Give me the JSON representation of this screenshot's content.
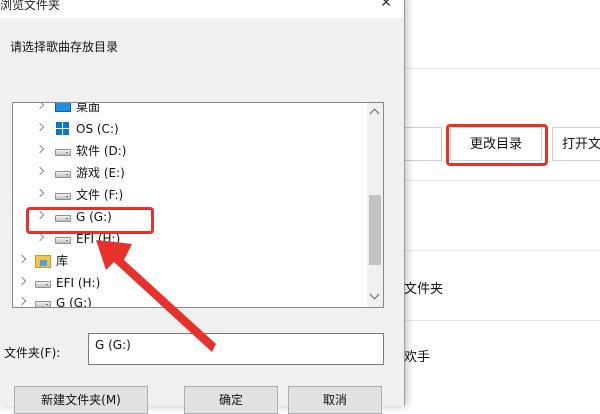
{
  "dialog": {
    "title": "浏览文件夹",
    "close_glyph": "✕",
    "prompt": "请选择歌曲存放目录",
    "tree": [
      {
        "label": "桌面",
        "icon": "desktop-icon",
        "expandable": true
      },
      {
        "label": "OS (C:)",
        "icon": "windows-drive-icon",
        "expandable": true
      },
      {
        "label": "软件 (D:)",
        "icon": "drive-icon",
        "expandable": true
      },
      {
        "label": "游戏 (E:)",
        "icon": "drive-icon",
        "expandable": true
      },
      {
        "label": "文件 (F:)",
        "icon": "drive-icon",
        "expandable": true
      },
      {
        "label": "G (G:)",
        "icon": "drive-icon",
        "expandable": true,
        "selected": true
      },
      {
        "label": "EFI (H:)",
        "icon": "drive-icon",
        "expandable": true
      },
      {
        "label": "库",
        "icon": "library-icon",
        "expandable": true
      },
      {
        "label": "EFI (H:)",
        "icon": "drive-icon",
        "expandable": true
      },
      {
        "label": "G (G:)",
        "icon": "drive-icon",
        "expandable": true
      }
    ],
    "folder_label": "文件夹(F):",
    "folder_value": "G (G:)",
    "buttons": {
      "new_folder": "新建文件夹(M)",
      "ok": "确定",
      "cancel": "取消"
    }
  },
  "background": {
    "change_dir_button": "更改目录",
    "open_button": "打开文",
    "folder_text": "文件夹",
    "partial_text": "欢手"
  },
  "colors": {
    "highlight": "#e8312b",
    "dialog_bg": "#f0f0f0"
  }
}
